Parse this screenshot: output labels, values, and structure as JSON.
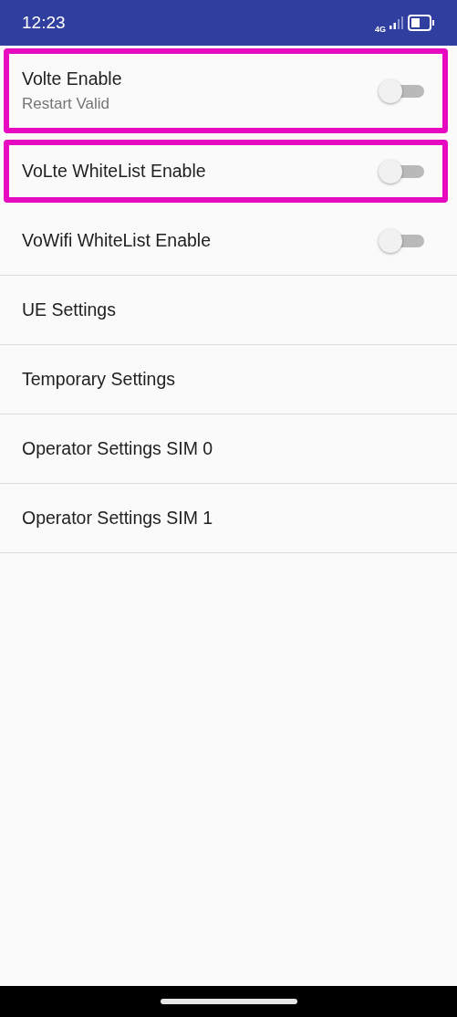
{
  "status_bar": {
    "time": "12:23",
    "network": "4G"
  },
  "settings": [
    {
      "kind": "switch",
      "title": "Volte Enable",
      "summary": "Restart Valid",
      "on": false,
      "highlighted": true
    },
    {
      "kind": "switch",
      "title": "VoLte WhiteList Enable",
      "on": false,
      "highlighted": true
    },
    {
      "kind": "switch",
      "title": "VoWifi WhiteList Enable",
      "on": false,
      "highlighted": false
    },
    {
      "kind": "link",
      "title": "UE Settings",
      "highlighted": false
    },
    {
      "kind": "link",
      "title": "Temporary Settings",
      "highlighted": false
    },
    {
      "kind": "link",
      "title": "Operator Settings SIM 0",
      "highlighted": false
    },
    {
      "kind": "link",
      "title": "Operator Settings SIM 1",
      "highlighted": false
    }
  ]
}
